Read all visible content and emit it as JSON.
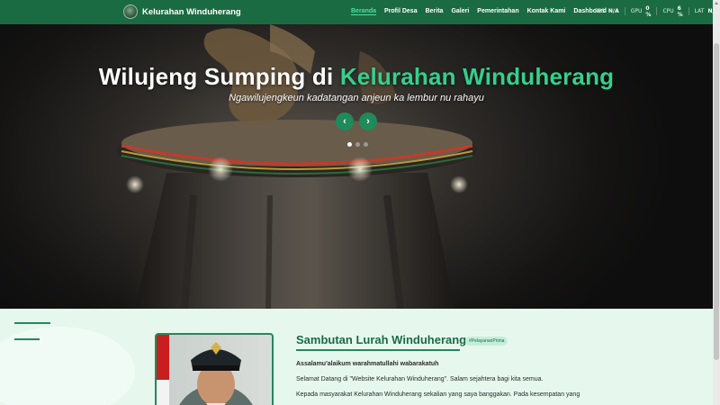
{
  "navbar": {
    "brand": "Kelurahan Winduherang",
    "menu": [
      {
        "label": "Beranda",
        "active": true
      },
      {
        "label": "Profil Desa",
        "active": false
      },
      {
        "label": "Berita",
        "active": false
      },
      {
        "label": "Galeri",
        "active": false
      },
      {
        "label": "Pemerintahan",
        "active": false
      },
      {
        "label": "Kontak Kami",
        "active": false
      },
      {
        "label": "Dashboard",
        "active": false
      }
    ],
    "perf": [
      {
        "label": "FPS",
        "value": "N/A"
      },
      {
        "label": "GPU",
        "value": "0 %"
      },
      {
        "label": "CPU",
        "value": "6 %"
      },
      {
        "label": "LAT",
        "value": "N/A"
      }
    ]
  },
  "hero": {
    "title_prefix": "Wilujeng Sumping di ",
    "title_accent": "Kelurahan Winduherang",
    "subtitle": "Ngawilujengkeun kadatangan anjeun ka lembur nu rahayu",
    "prev_icon": "chevron-left-icon",
    "next_icon": "chevron-right-icon",
    "prev_glyph": "‹",
    "next_glyph": "›",
    "slides": 3,
    "active_slide": 1
  },
  "welcome": {
    "title": "Sambutan Lurah Winduherang",
    "tag": "#PelayananPrima",
    "greeting": "Assalamu'alaikum warahmatullahi wabarakatuh",
    "line1": "Selamat Datang di \"Website Kelurahan Winduherang\". Salam sejahtera bagi kita semua.",
    "line2": "Kepada masyarakat Kelurahan Winduherang sekalian yang saya banggakan. Pada kesempatan yang"
  },
  "colors": {
    "brand_green": "#1a6b42",
    "accent_green": "#34d08d",
    "section_bg": "#e6f8ee"
  }
}
